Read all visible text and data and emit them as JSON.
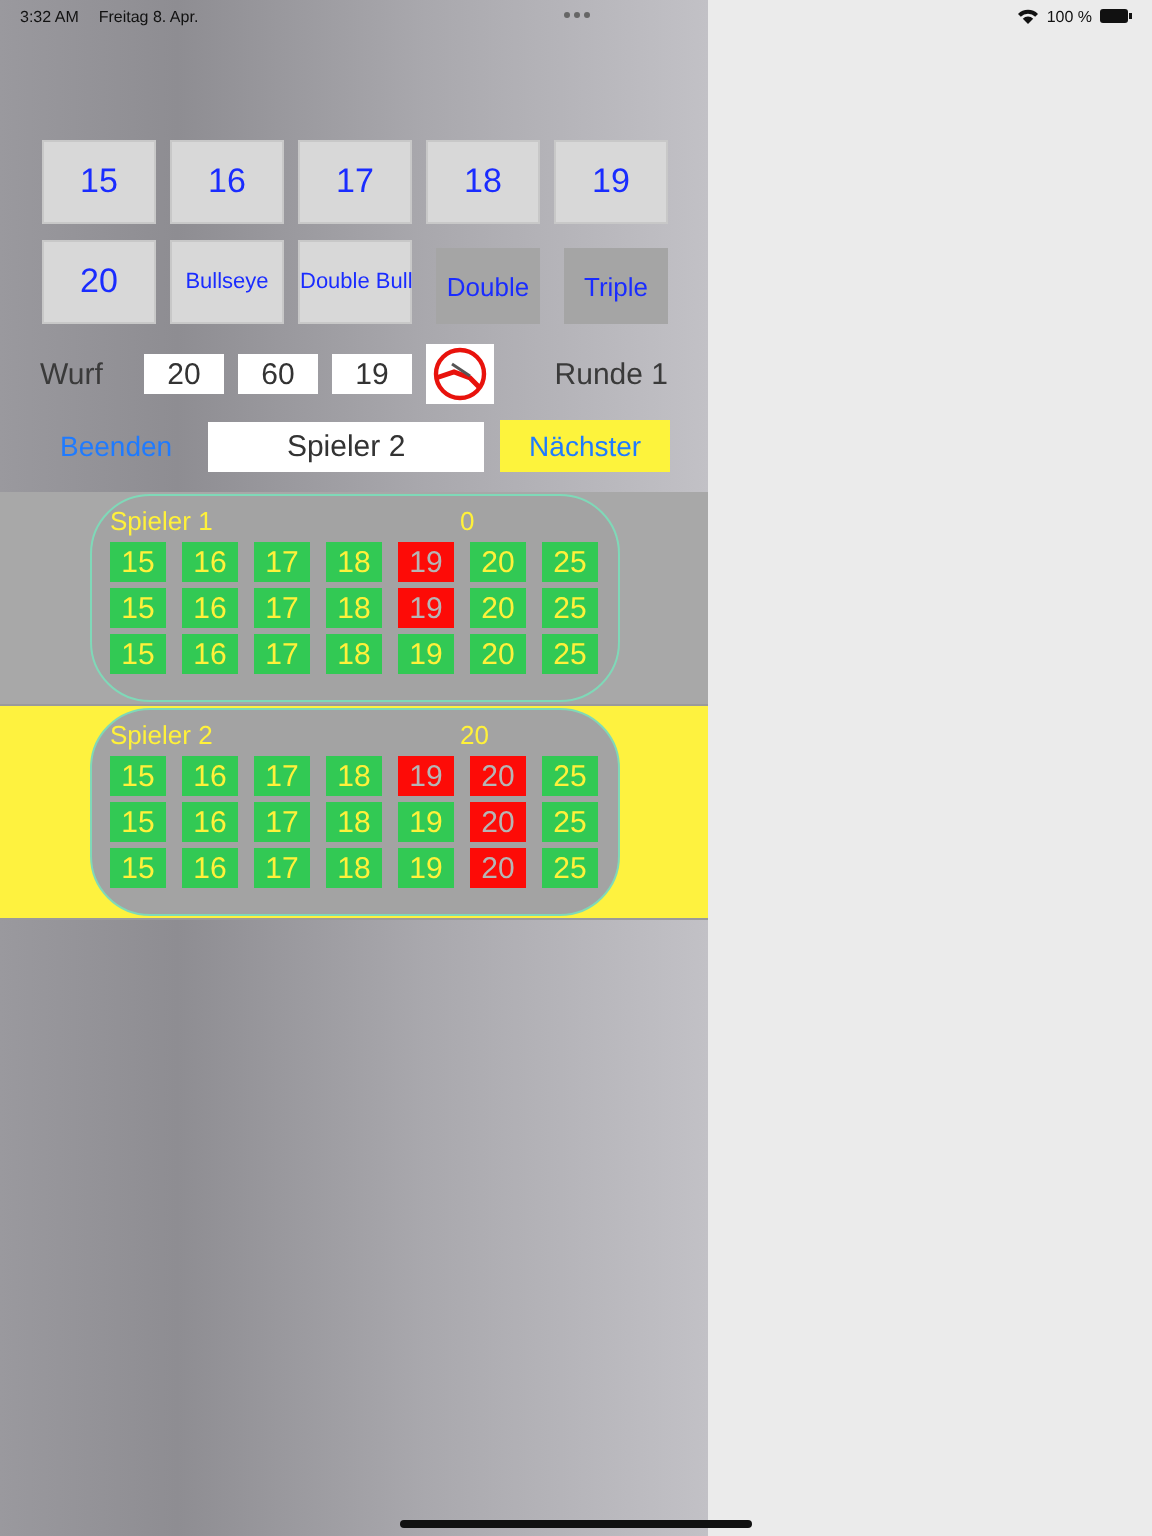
{
  "status_bar": {
    "time": "3:32 AM",
    "date": "Freitag 8. Apr.",
    "battery": "100 %"
  },
  "number_buttons": [
    {
      "label": "15",
      "kind": "number"
    },
    {
      "label": "16",
      "kind": "number"
    },
    {
      "label": "17",
      "kind": "number"
    },
    {
      "label": "18",
      "kind": "number"
    },
    {
      "label": "19",
      "kind": "number"
    },
    {
      "label": "20",
      "kind": "number"
    },
    {
      "label": "Bullseye",
      "kind": "small"
    },
    {
      "label": "Double Bull",
      "kind": "small"
    },
    {
      "label": "Double",
      "kind": "toggle",
      "on": false
    },
    {
      "label": "Triple",
      "kind": "toggle",
      "on": false
    }
  ],
  "throw_row": {
    "label": "Wurf",
    "values": [
      "20",
      "60",
      "19"
    ],
    "round": "Runde 1"
  },
  "action_row": {
    "quit": "Beenden",
    "player_field": "Spieler 2",
    "next": "Nächster"
  },
  "players": [
    {
      "name": "Spieler 1",
      "score": "0",
      "selected": false,
      "rows": [
        [
          {
            "label": "15",
            "hit": false
          },
          {
            "label": "16",
            "hit": false
          },
          {
            "label": "17",
            "hit": false
          },
          {
            "label": "18",
            "hit": false
          },
          {
            "label": "19",
            "hit": true
          },
          {
            "label": "20",
            "hit": false
          },
          {
            "label": "25",
            "hit": false
          }
        ],
        [
          {
            "label": "15",
            "hit": false
          },
          {
            "label": "16",
            "hit": false
          },
          {
            "label": "17",
            "hit": false
          },
          {
            "label": "18",
            "hit": false
          },
          {
            "label": "19",
            "hit": true
          },
          {
            "label": "20",
            "hit": false
          },
          {
            "label": "25",
            "hit": false
          }
        ],
        [
          {
            "label": "15",
            "hit": false
          },
          {
            "label": "16",
            "hit": false
          },
          {
            "label": "17",
            "hit": false
          },
          {
            "label": "18",
            "hit": false
          },
          {
            "label": "19",
            "hit": false
          },
          {
            "label": "20",
            "hit": false
          },
          {
            "label": "25",
            "hit": false
          }
        ]
      ]
    },
    {
      "name": "Spieler 2",
      "score": "20",
      "selected": true,
      "rows": [
        [
          {
            "label": "15",
            "hit": false
          },
          {
            "label": "16",
            "hit": false
          },
          {
            "label": "17",
            "hit": false
          },
          {
            "label": "18",
            "hit": false
          },
          {
            "label": "19",
            "hit": true
          },
          {
            "label": "20",
            "hit": true
          },
          {
            "label": "25",
            "hit": false
          }
        ],
        [
          {
            "label": "15",
            "hit": false
          },
          {
            "label": "16",
            "hit": false
          },
          {
            "label": "17",
            "hit": false
          },
          {
            "label": "18",
            "hit": false
          },
          {
            "label": "19",
            "hit": false
          },
          {
            "label": "20",
            "hit": true
          },
          {
            "label": "25",
            "hit": false
          }
        ],
        [
          {
            "label": "15",
            "hit": false
          },
          {
            "label": "16",
            "hit": false
          },
          {
            "label": "17",
            "hit": false
          },
          {
            "label": "18",
            "hit": false
          },
          {
            "label": "19",
            "hit": false
          },
          {
            "label": "20",
            "hit": true
          },
          {
            "label": "25",
            "hit": false
          }
        ]
      ]
    }
  ]
}
